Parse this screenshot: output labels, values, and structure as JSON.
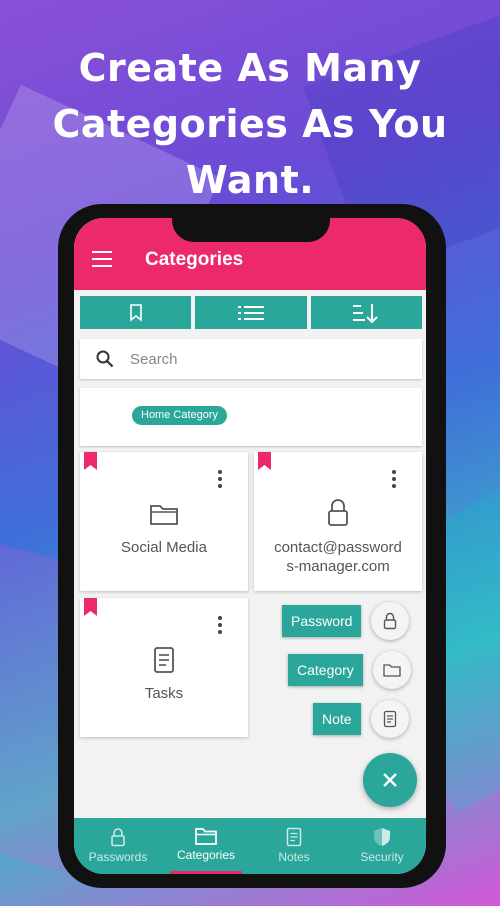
{
  "headline": {
    "line1": "Create As Many",
    "line2": "Categories As You Want."
  },
  "appbar": {
    "title": "Categories"
  },
  "search": {
    "placeholder": "Search"
  },
  "home_category": {
    "chip": "Home Category"
  },
  "cards": [
    {
      "label": "Social Media",
      "icon": "folder-icon"
    },
    {
      "label_line1": "contact@password",
      "label_line2": "s-manager.com",
      "icon": "lock-icon"
    },
    {
      "label": "Tasks",
      "icon": "note-icon"
    }
  ],
  "fab_menu": {
    "password": "Password",
    "category": "Category",
    "note": "Note"
  },
  "bottom_nav": {
    "items": [
      {
        "label": "Passwords",
        "icon": "lock-icon"
      },
      {
        "label": "Categories",
        "icon": "folder-icon",
        "active": true
      },
      {
        "label": "Notes",
        "icon": "note-icon"
      },
      {
        "label": "Security",
        "icon": "shield-icon"
      }
    ]
  },
  "colors": {
    "primary": "#ec2a6a",
    "accent": "#2aa69a"
  }
}
